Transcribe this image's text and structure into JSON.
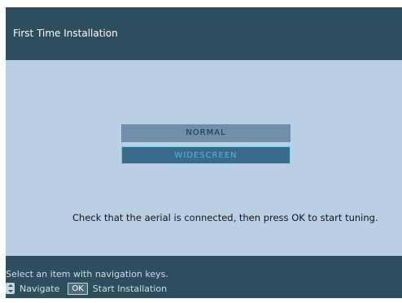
{
  "header": {
    "title": "First Time Installation"
  },
  "options": {
    "items": [
      "NORMAL",
      "WIDESCREEN"
    ],
    "selected": "WIDESCREEN"
  },
  "instruction": "Check that the aerial is connected, then press OK to start tuning.",
  "footer": {
    "hint": "Select an item with navigation keys.",
    "navigate_icon": "up-down-arrows-icon",
    "navigate_label": "Navigate",
    "ok_key": "OK",
    "ok_label": "Start Installation"
  },
  "colors": {
    "header_bg": "#2d4e5f",
    "body_bg": "#bacfe3",
    "selected_text": "#49bbe2",
    "selected_bg": "#3c6a8a",
    "option_bg": "#6d8fa9"
  }
}
